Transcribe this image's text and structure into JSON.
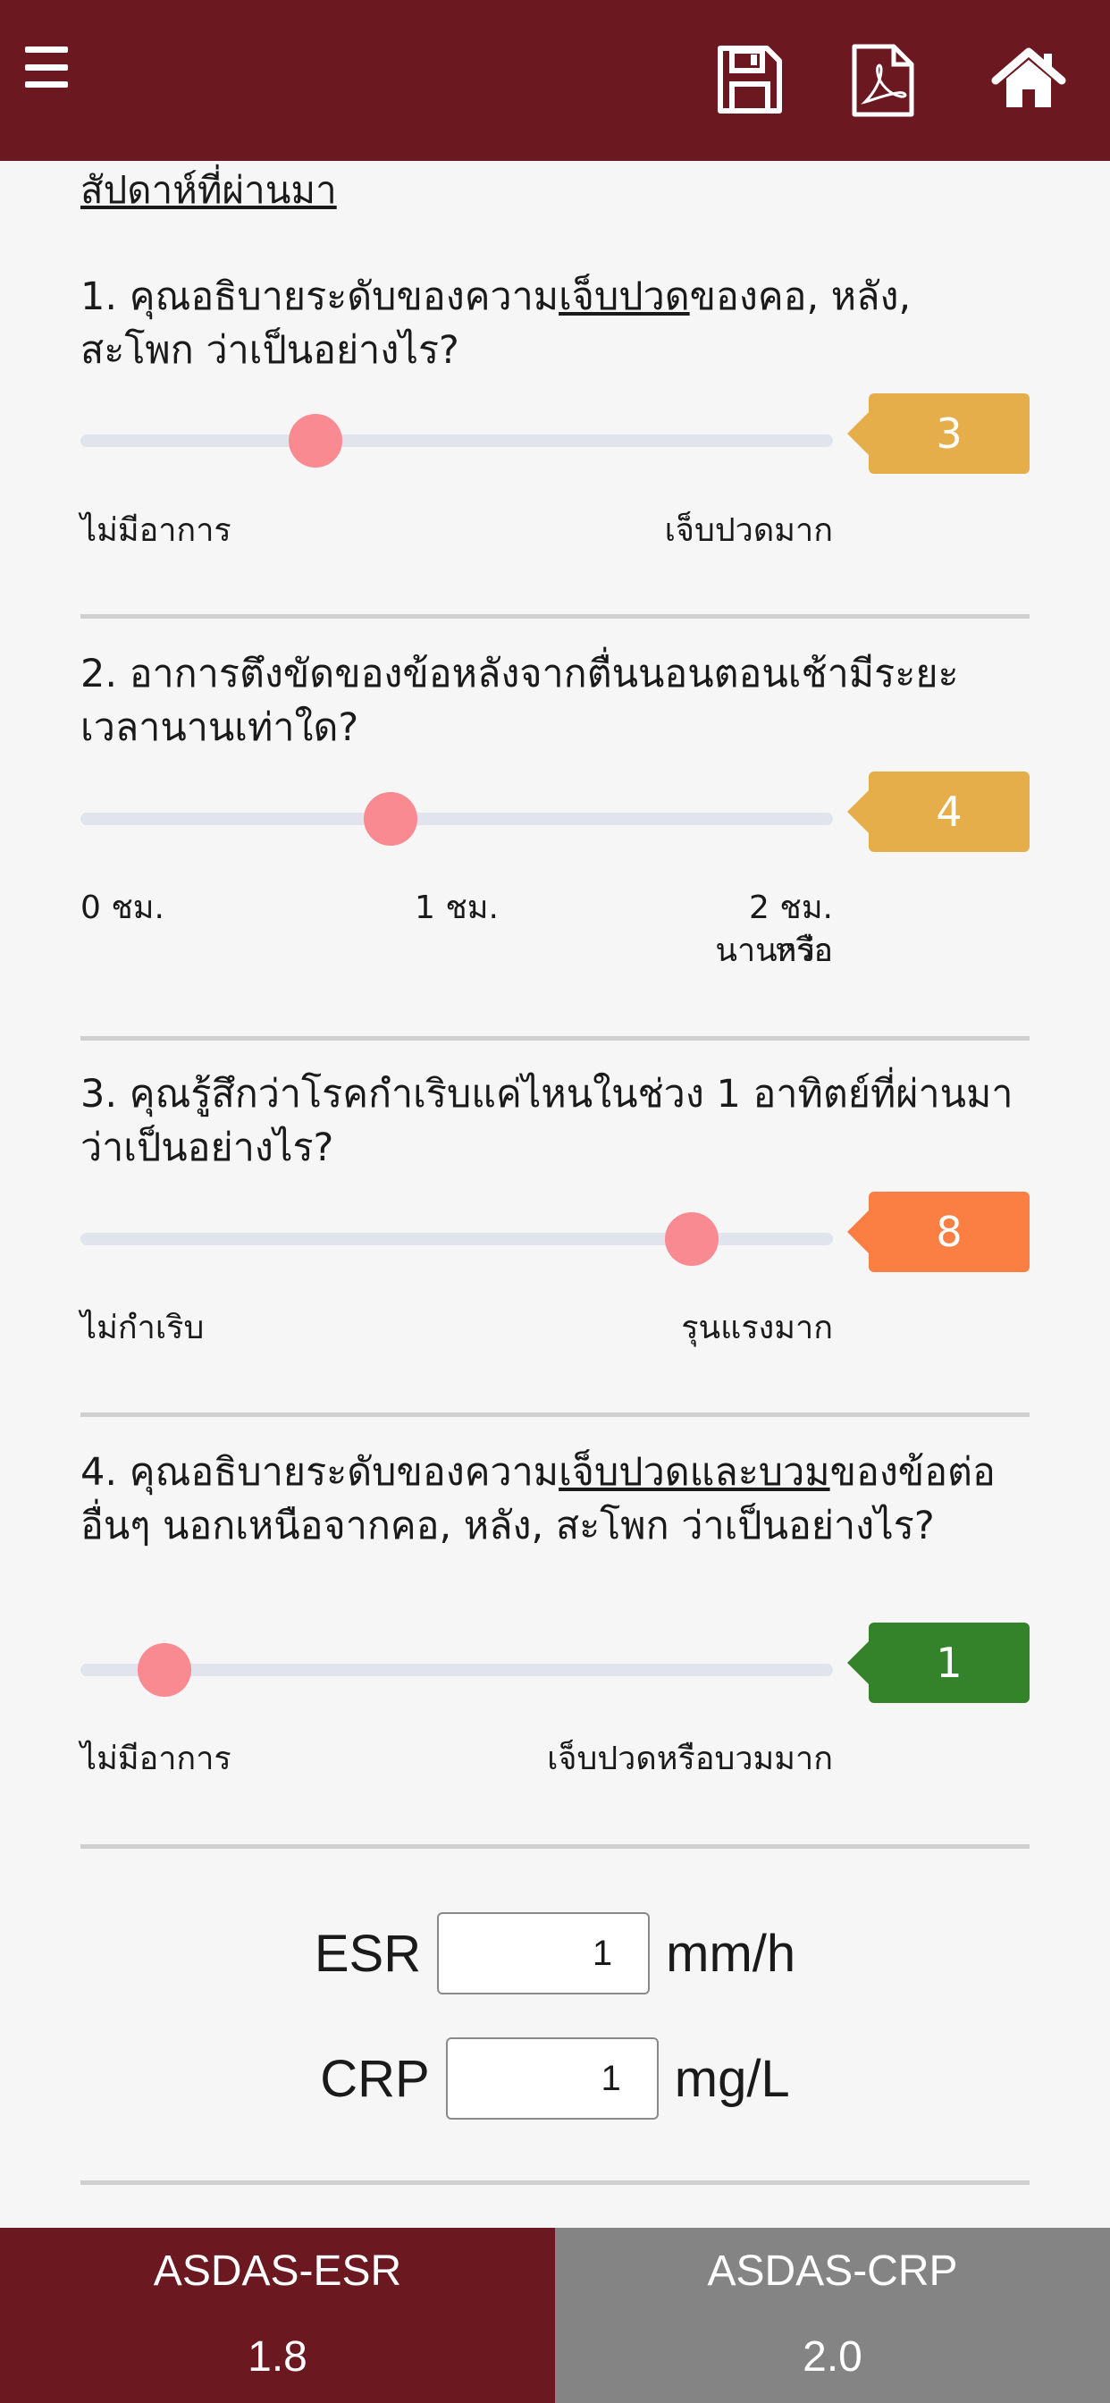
{
  "header": {
    "menu_icon": "hamburger-icon",
    "save_icon": "floppy-disk-icon",
    "pdf_icon": "pdf-file-icon",
    "home_icon": "home-icon",
    "bg_color": "#6b1820"
  },
  "subtitle": "สัปดาห์ที่ผ่านมา",
  "questions": [
    {
      "number": "1.",
      "text_before": "คุณอธิบายระดับของความ",
      "text_underline": "เจ็บปวด",
      "text_after": "ของคอ, หลัง, สะโพก ว่าเป็นอย่างไร?",
      "value": 3,
      "min": 0,
      "max": 10,
      "badge_color": "#e6ae4b",
      "labels": [
        "ไม่มีอาการ",
        "เจ็บปวดมาก"
      ]
    },
    {
      "number": "2.",
      "text_before": "อาการตึงขัดของข้อหลังจากตื่นนอนตอนเช้ามีระยะเวลานานเท่าใด?",
      "text_underline": "",
      "text_after": "",
      "value": 4,
      "min": 0,
      "max": 10,
      "badge_color": "#e6ae4b",
      "labels": [
        "0 ชม.",
        "1 ชม.",
        "2 ชม. หรือ",
        "นานกว่า"
      ]
    },
    {
      "number": "3.",
      "text_before": "คุณรู้สึกว่าโรคกำเริบแค่ไหนในช่วง 1 อาทิตย์ที่ผ่านมา ว่าเป็นอย่างไร?",
      "text_underline": "",
      "text_after": "",
      "value": 8,
      "min": 0,
      "max": 10,
      "badge_color": "#fb7f43",
      "labels": [
        "ไม่กำเริบ",
        "รุนแรงมาก"
      ]
    },
    {
      "number": "4.",
      "text_before": "คุณอธิบายระดับของความ",
      "text_underline": "เจ็บปวดและบวม",
      "text_after": "ของข้อต่ออื่นๆ นอกเหนือจากคอ, หลัง, สะโพก ว่าเป็นอย่างไร?",
      "value": 1,
      "min": 0,
      "max": 10,
      "badge_color": "#34822a",
      "labels": [
        "ไม่มีอาการ",
        "เจ็บปวดหรือบวมมาก"
      ]
    }
  ],
  "labs": {
    "esr": {
      "label": "ESR",
      "value": "1",
      "unit": "mm/h"
    },
    "crp": {
      "label": "CRP",
      "value": "1",
      "unit": "mg/L"
    }
  },
  "footer": {
    "tabs": [
      {
        "label": "ASDAS-ESR",
        "value": "1.8",
        "color": "#6b1820"
      },
      {
        "label": "ASDAS-CRP",
        "value": "2.0",
        "color": "#848484"
      }
    ]
  }
}
